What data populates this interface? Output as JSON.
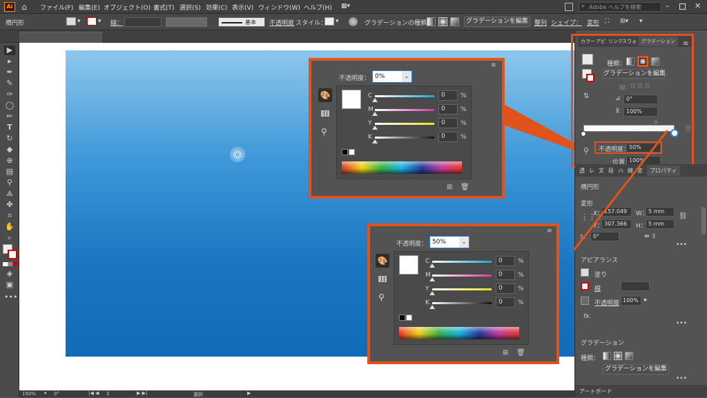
{
  "app": {
    "logo": "Ai"
  },
  "menu": [
    "ファイル(F)",
    "編集(E)",
    "オブジェクト(O)",
    "書式(T)",
    "選択(S)",
    "効果(C)",
    "表示(V)",
    "ウィンドウ(W)",
    "ヘルプ(H)"
  ],
  "search": {
    "placeholder": "Adobe ヘルプを検索"
  },
  "control": {
    "object_label": "楕円形",
    "stroke_label": "線：",
    "stroke_style": "基本",
    "opacity_label": "不透明度",
    "style_label": "スタイル：",
    "gradient_type_label": "グラデーションの種類：",
    "edit_gradient_button": "グラデーションを編集",
    "align_label": "整列",
    "shape_label": "シェイプ：",
    "transform_label": "変形"
  },
  "popup1": {
    "opacity_label": "不透明度：",
    "opacity_value": "0%",
    "channels": [
      {
        "name": "C",
        "value": "0"
      },
      {
        "name": "M",
        "value": "0"
      },
      {
        "name": "Y",
        "value": "0"
      },
      {
        "name": "K",
        "value": "0"
      }
    ],
    "unit": "%"
  },
  "popup2": {
    "opacity_label": "不透明度：",
    "opacity_value": "50%",
    "channels": [
      {
        "name": "C",
        "value": "0"
      },
      {
        "name": "M",
        "value": "0"
      },
      {
        "name": "Y",
        "value": "0"
      },
      {
        "name": "K",
        "value": "0"
      }
    ],
    "unit": "%"
  },
  "gradient_panel": {
    "tabs": [
      "カラー",
      "アピ",
      "リンク",
      "スウォ",
      "グラデーション"
    ],
    "type_label": "種類：",
    "edit_button": "グラデーションを編集",
    "stroke_label": "線：",
    "angle_value": "0°",
    "aspect_value": "100%",
    "opacity_label": "不透明度：",
    "opacity_value": "50%",
    "position_label": "位置：",
    "position_value": "100%"
  },
  "properties_panel": {
    "tabs": [
      "透",
      "レ",
      "文",
      "段",
      "ハ",
      "線",
      "変",
      "プロパティ"
    ],
    "object_name": "楕円形",
    "transform_header": "変形",
    "x_label": "X：",
    "x_value": "157.049",
    "y_label": "Y：",
    "y_value": "307.366",
    "w_label": "W：",
    "w_value": "5 mm",
    "h_label": "H：",
    "h_value": "5 mm",
    "rotate_value": "0°",
    "appearance_header": "アピアランス",
    "fill_label": "塗り",
    "stroke_label": "線",
    "opacity_label": "不透明度",
    "opacity_value": "100%",
    "fx_label": "fx.",
    "gradient_header": "グラデーション",
    "gradient_type_label": "種類：",
    "edit_gradient_button": "グラデーションを編集",
    "artboard_label": "アートボード"
  },
  "statusbar": {
    "zoom": "150%",
    "rotation": "0°",
    "artboard_number": "2",
    "tool_status": "選択"
  },
  "colors": {
    "highlight": "#e0541c",
    "panel_bg": "#535353",
    "canvas_gradient_top": "#8ec7ec",
    "canvas_gradient_bottom": "#106cb8"
  }
}
